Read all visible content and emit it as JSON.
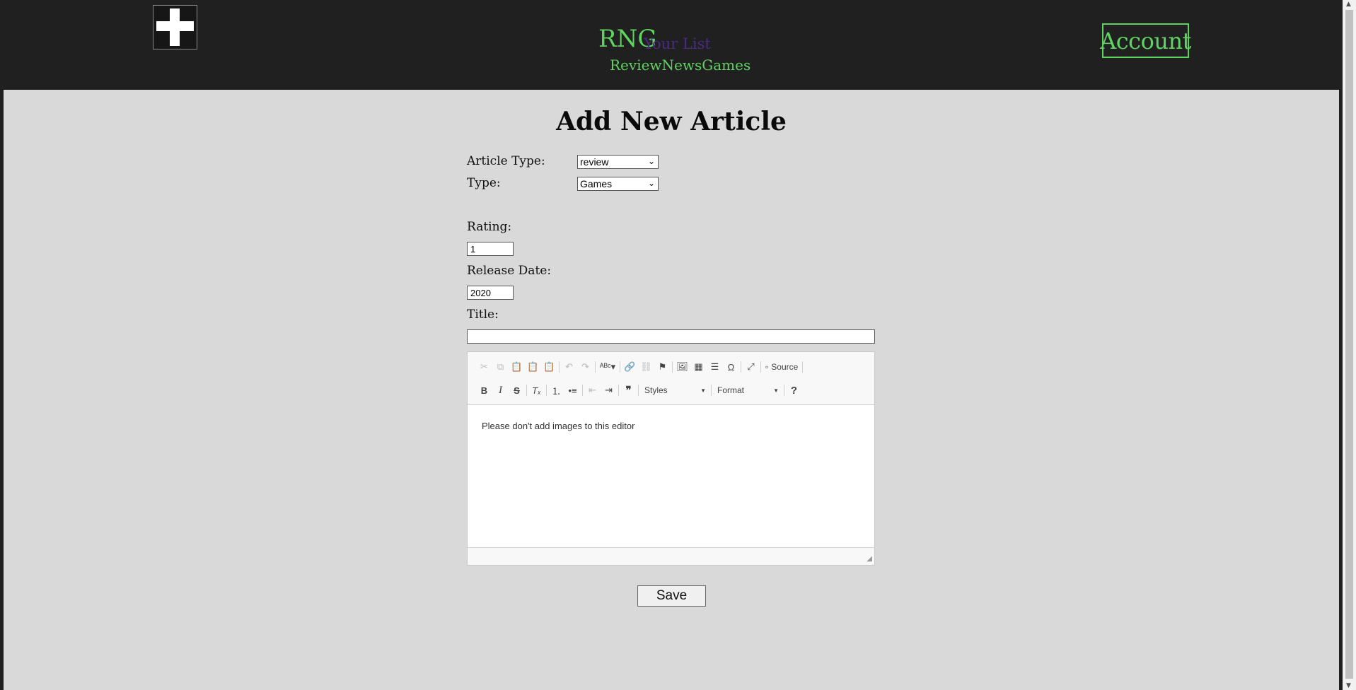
{
  "header": {
    "brand": "RNG",
    "your_list": "Your List",
    "nav": [
      "Review",
      "News",
      "Games"
    ],
    "account": "Account"
  },
  "form": {
    "title": "Add New Article",
    "article_type_label": "Article Type:",
    "article_type_value": "review",
    "type_label": "Type:",
    "type_value": "Games",
    "rating_label": "Rating:",
    "rating_value": "1",
    "release_label": "Release Date:",
    "release_value": "2020",
    "title_label": "Title:",
    "title_value": "",
    "save": "Save"
  },
  "editor": {
    "source_label": "Source",
    "styles_label": "Styles",
    "format_label": "Format",
    "content": "Please don't add images to this editor"
  },
  "colors": {
    "accent": "#5fd35f",
    "your_list": "#4b2a84",
    "header_bg": "#202020",
    "page_bg": "#d9d9d9"
  }
}
